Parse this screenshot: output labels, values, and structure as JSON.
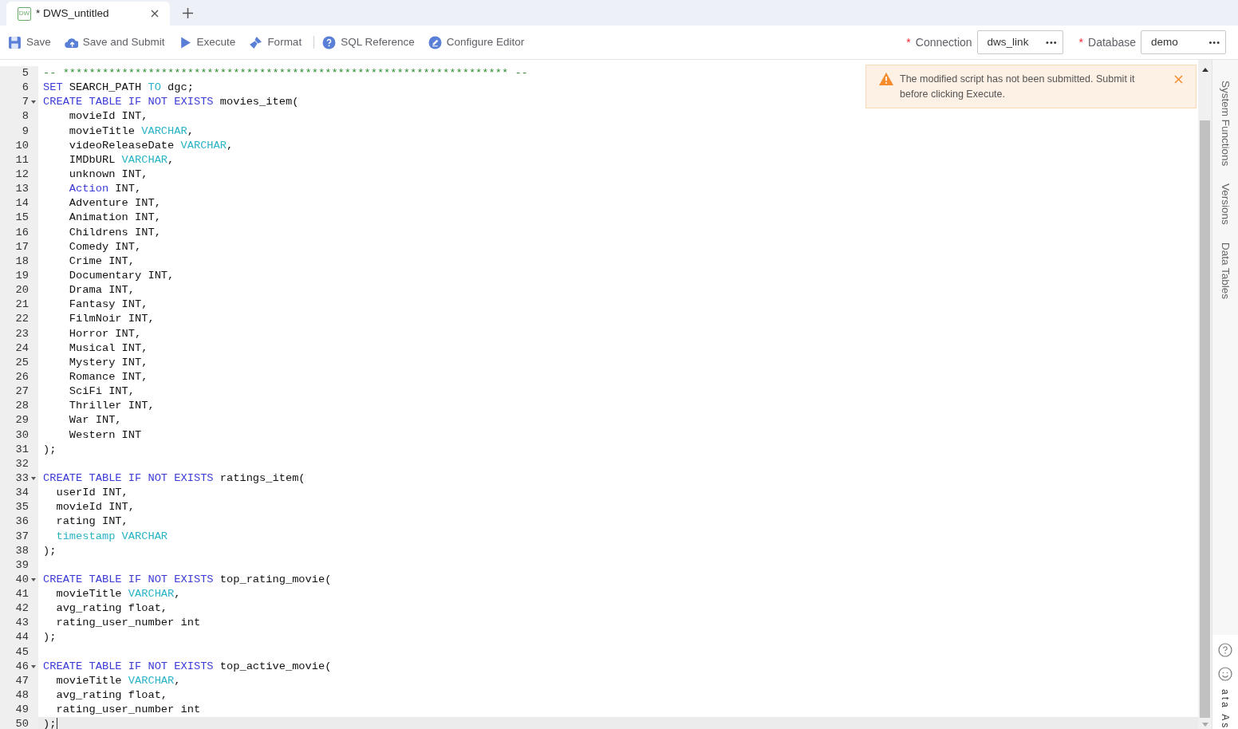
{
  "tabs": [
    {
      "label": "* DWS_untitled",
      "selected": true,
      "badge": "DW"
    }
  ],
  "toolbar": [
    "Save",
    "Save and Submit",
    "Execute",
    "Format",
    "SQL Reference",
    "Configure Editor"
  ],
  "connection": {
    "label": "Connection",
    "value": "dws_link",
    "more": "•••"
  },
  "database": {
    "label": "Database",
    "value": "demo",
    "more": "•••"
  },
  "required_mark": "*",
  "notice": {
    "text": "The modified script has not been submitted. Submit it before clicking Execute."
  },
  "side_tabs": [
    "System Functions",
    "Versions",
    "Data Tables"
  ],
  "side_bottom_text": "ata As",
  "code_lines": [
    {
      "number": "5",
      "foldable": false,
      "current": false,
      "tokens": [
        {
          "kind": "comment",
          "text": "-- ******************************************************************** --"
        }
      ]
    },
    {
      "number": "6",
      "foldable": false,
      "current": false,
      "tokens": [
        {
          "kind": "keyword",
          "text": "SET"
        },
        {
          "kind": "plain",
          "text": " SEARCH_PATH "
        },
        {
          "kind": "type",
          "text": "TO"
        },
        {
          "kind": "plain",
          "text": " dgc;"
        }
      ]
    },
    {
      "number": "7",
      "foldable": true,
      "current": false,
      "tokens": [
        {
          "kind": "keyword",
          "text": "CREATE TABLE IF NOT EXISTS"
        },
        {
          "kind": "plain",
          "text": " movies_item("
        }
      ]
    },
    {
      "number": "8",
      "foldable": false,
      "current": false,
      "tokens": [
        {
          "kind": "plain",
          "text": "    movieId INT,"
        }
      ]
    },
    {
      "number": "9",
      "foldable": false,
      "current": false,
      "tokens": [
        {
          "kind": "plain",
          "text": "    movieTitle "
        },
        {
          "kind": "type",
          "text": "VARCHAR"
        },
        {
          "kind": "plain",
          "text": ","
        }
      ]
    },
    {
      "number": "10",
      "foldable": false,
      "current": false,
      "tokens": [
        {
          "kind": "plain",
          "text": "    videoReleaseDate "
        },
        {
          "kind": "type",
          "text": "VARCHAR"
        },
        {
          "kind": "plain",
          "text": ","
        }
      ]
    },
    {
      "number": "11",
      "foldable": false,
      "current": false,
      "tokens": [
        {
          "kind": "plain",
          "text": "    IMDbURL "
        },
        {
          "kind": "type",
          "text": "VARCHAR"
        },
        {
          "kind": "plain",
          "text": ","
        }
      ]
    },
    {
      "number": "12",
      "foldable": false,
      "current": false,
      "tokens": [
        {
          "kind": "plain",
          "text": "    unknown INT,"
        }
      ]
    },
    {
      "number": "13",
      "foldable": false,
      "current": false,
      "tokens": [
        {
          "kind": "keyword",
          "text": "    Action"
        },
        {
          "kind": "plain",
          "text": " INT,"
        }
      ]
    },
    {
      "number": "14",
      "foldable": false,
      "current": false,
      "tokens": [
        {
          "kind": "plain",
          "text": "    Adventure INT,"
        }
      ]
    },
    {
      "number": "15",
      "foldable": false,
      "current": false,
      "tokens": [
        {
          "kind": "plain",
          "text": "    Animation INT,"
        }
      ]
    },
    {
      "number": "16",
      "foldable": false,
      "current": false,
      "tokens": [
        {
          "kind": "plain",
          "text": "    Childrens INT,"
        }
      ]
    },
    {
      "number": "17",
      "foldable": false,
      "current": false,
      "tokens": [
        {
          "kind": "plain",
          "text": "    Comedy INT,"
        }
      ]
    },
    {
      "number": "18",
      "foldable": false,
      "current": false,
      "tokens": [
        {
          "kind": "plain",
          "text": "    Crime INT,"
        }
      ]
    },
    {
      "number": "19",
      "foldable": false,
      "current": false,
      "tokens": [
        {
          "kind": "plain",
          "text": "    Documentary INT,"
        }
      ]
    },
    {
      "number": "20",
      "foldable": false,
      "current": false,
      "tokens": [
        {
          "kind": "plain",
          "text": "    Drama INT,"
        }
      ]
    },
    {
      "number": "21",
      "foldable": false,
      "current": false,
      "tokens": [
        {
          "kind": "plain",
          "text": "    Fantasy INT,"
        }
      ]
    },
    {
      "number": "22",
      "foldable": false,
      "current": false,
      "tokens": [
        {
          "kind": "plain",
          "text": "    FilmNoir INT,"
        }
      ]
    },
    {
      "number": "23",
      "foldable": false,
      "current": false,
      "tokens": [
        {
          "kind": "plain",
          "text": "    Horror INT,"
        }
      ]
    },
    {
      "number": "24",
      "foldable": false,
      "current": false,
      "tokens": [
        {
          "kind": "plain",
          "text": "    Musical INT,"
        }
      ]
    },
    {
      "number": "25",
      "foldable": false,
      "current": false,
      "tokens": [
        {
          "kind": "plain",
          "text": "    Mystery INT,"
        }
      ]
    },
    {
      "number": "26",
      "foldable": false,
      "current": false,
      "tokens": [
        {
          "kind": "plain",
          "text": "    Romance INT,"
        }
      ]
    },
    {
      "number": "27",
      "foldable": false,
      "current": false,
      "tokens": [
        {
          "kind": "plain",
          "text": "    SciFi INT,"
        }
      ]
    },
    {
      "number": "28",
      "foldable": false,
      "current": false,
      "tokens": [
        {
          "kind": "plain",
          "text": "    Thriller INT,"
        }
      ]
    },
    {
      "number": "29",
      "foldable": false,
      "current": false,
      "tokens": [
        {
          "kind": "plain",
          "text": "    War INT,"
        }
      ]
    },
    {
      "number": "30",
      "foldable": false,
      "current": false,
      "tokens": [
        {
          "kind": "plain",
          "text": "    Western INT"
        }
      ]
    },
    {
      "number": "31",
      "foldable": false,
      "current": false,
      "tokens": [
        {
          "kind": "plain",
          "text": ");"
        }
      ]
    },
    {
      "number": "32",
      "foldable": false,
      "current": false
    },
    {
      "number": "33",
      "foldable": true,
      "current": false,
      "tokens": [
        {
          "kind": "keyword",
          "text": "CREATE TABLE IF NOT EXISTS"
        },
        {
          "kind": "plain",
          "text": " ratings_item("
        }
      ]
    },
    {
      "number": "34",
      "foldable": false,
      "current": false,
      "tokens": [
        {
          "kind": "plain",
          "text": "  userId INT,"
        }
      ]
    },
    {
      "number": "35",
      "foldable": false,
      "current": false,
      "tokens": [
        {
          "kind": "plain",
          "text": "  movieId INT,"
        }
      ]
    },
    {
      "number": "36",
      "foldable": false,
      "current": false,
      "tokens": [
        {
          "kind": "plain",
          "text": "  rating INT,"
        }
      ]
    },
    {
      "number": "37",
      "foldable": false,
      "current": false,
      "tokens": [
        {
          "kind": "type",
          "text": "  timestamp VARCHAR"
        }
      ]
    },
    {
      "number": "38",
      "foldable": false,
      "current": false,
      "tokens": [
        {
          "kind": "plain",
          "text": ");"
        }
      ]
    },
    {
      "number": "39",
      "foldable": false,
      "current": false
    },
    {
      "number": "40",
      "foldable": true,
      "current": false,
      "tokens": [
        {
          "kind": "keyword",
          "text": "CREATE TABLE IF NOT EXISTS"
        },
        {
          "kind": "plain",
          "text": " top_rating_movie("
        }
      ]
    },
    {
      "number": "41",
      "foldable": false,
      "current": false,
      "tokens": [
        {
          "kind": "plain",
          "text": "  movieTitle "
        },
        {
          "kind": "type",
          "text": "VARCHAR"
        },
        {
          "kind": "plain",
          "text": ","
        }
      ]
    },
    {
      "number": "42",
      "foldable": false,
      "current": false,
      "tokens": [
        {
          "kind": "plain",
          "text": "  avg_rating float,"
        }
      ]
    },
    {
      "number": "43",
      "foldable": false,
      "current": false,
      "tokens": [
        {
          "kind": "plain",
          "text": "  rating_user_number int"
        }
      ]
    },
    {
      "number": "44",
      "foldable": false,
      "current": false,
      "tokens": [
        {
          "kind": "plain",
          "text": ");"
        }
      ]
    },
    {
      "number": "45",
      "foldable": false,
      "current": false
    },
    {
      "number": "46",
      "foldable": true,
      "current": false,
      "tokens": [
        {
          "kind": "keyword",
          "text": "CREATE TABLE IF NOT EXISTS"
        },
        {
          "kind": "plain",
          "text": " top_active_movie("
        }
      ]
    },
    {
      "number": "47",
      "foldable": false,
      "current": false,
      "tokens": [
        {
          "kind": "plain",
          "text": "  movieTitle "
        },
        {
          "kind": "type",
          "text": "VARCHAR"
        },
        {
          "kind": "plain",
          "text": ","
        }
      ]
    },
    {
      "number": "48",
      "foldable": false,
      "current": false,
      "tokens": [
        {
          "kind": "plain",
          "text": "  avg_rating float,"
        }
      ]
    },
    {
      "number": "49",
      "foldable": false,
      "current": false,
      "tokens": [
        {
          "kind": "plain",
          "text": "  rating_user_number int"
        }
      ]
    },
    {
      "number": "50",
      "foldable": false,
      "current": true,
      "tokens": [
        {
          "kind": "plain",
          "text": ");"
        }
      ]
    }
  ]
}
